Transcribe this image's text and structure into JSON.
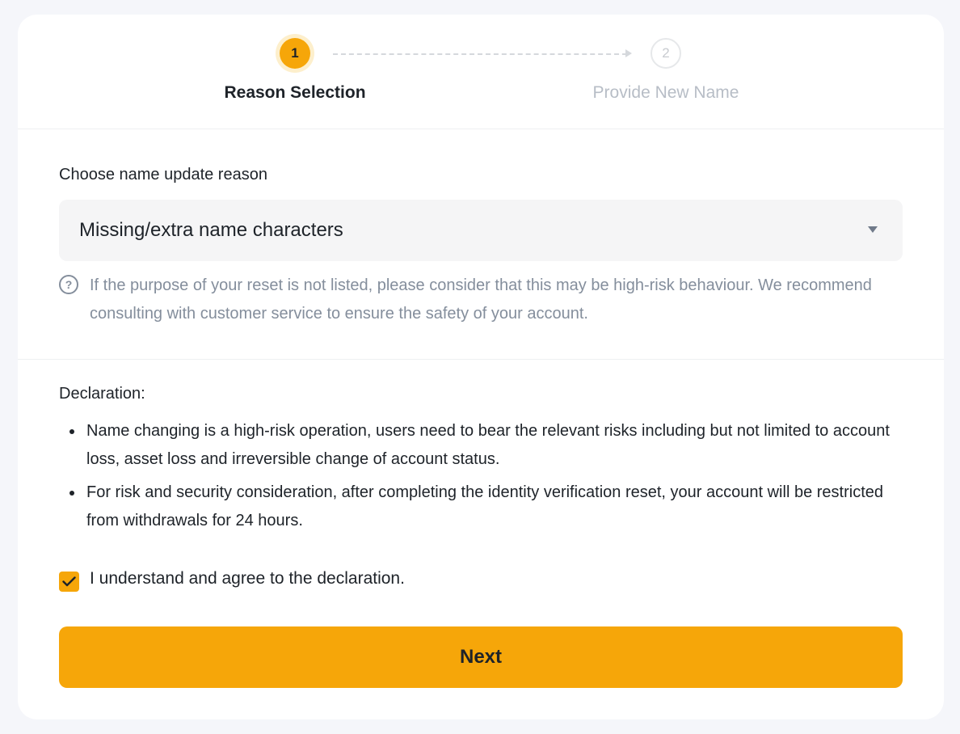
{
  "stepper": {
    "steps": [
      {
        "number": "1",
        "label": "Reason Selection",
        "state": "active"
      },
      {
        "number": "2",
        "label": "Provide New Name",
        "state": "inactive"
      }
    ]
  },
  "reason": {
    "title": "Choose name update reason",
    "selected": "Missing/extra name characters",
    "help_text": "If the purpose of your reset is not listed, please consider that this may be high-risk behaviour. We recommend consulting with customer service to ensure the safety of your account."
  },
  "declaration": {
    "title": "Declaration:",
    "items": [
      "Name changing is a high-risk operation, users need to bear the relevant risks including but not limited to account loss, asset loss and irreversible change of account status.",
      "For risk and security consideration, after completing the identity verification reset, your account will be restricted from withdrawals for 24 hours."
    ],
    "agree_label": "I understand and agree to the declaration.",
    "agree_checked": true
  },
  "actions": {
    "next_label": "Next"
  },
  "colors": {
    "accent": "#f6a609",
    "text": "#1e2329",
    "muted": "#848e9c"
  },
  "icons": {
    "help": "question-circle-icon",
    "caret": "caret-down-icon",
    "check": "check-icon",
    "arrow": "arrow-right-icon"
  }
}
